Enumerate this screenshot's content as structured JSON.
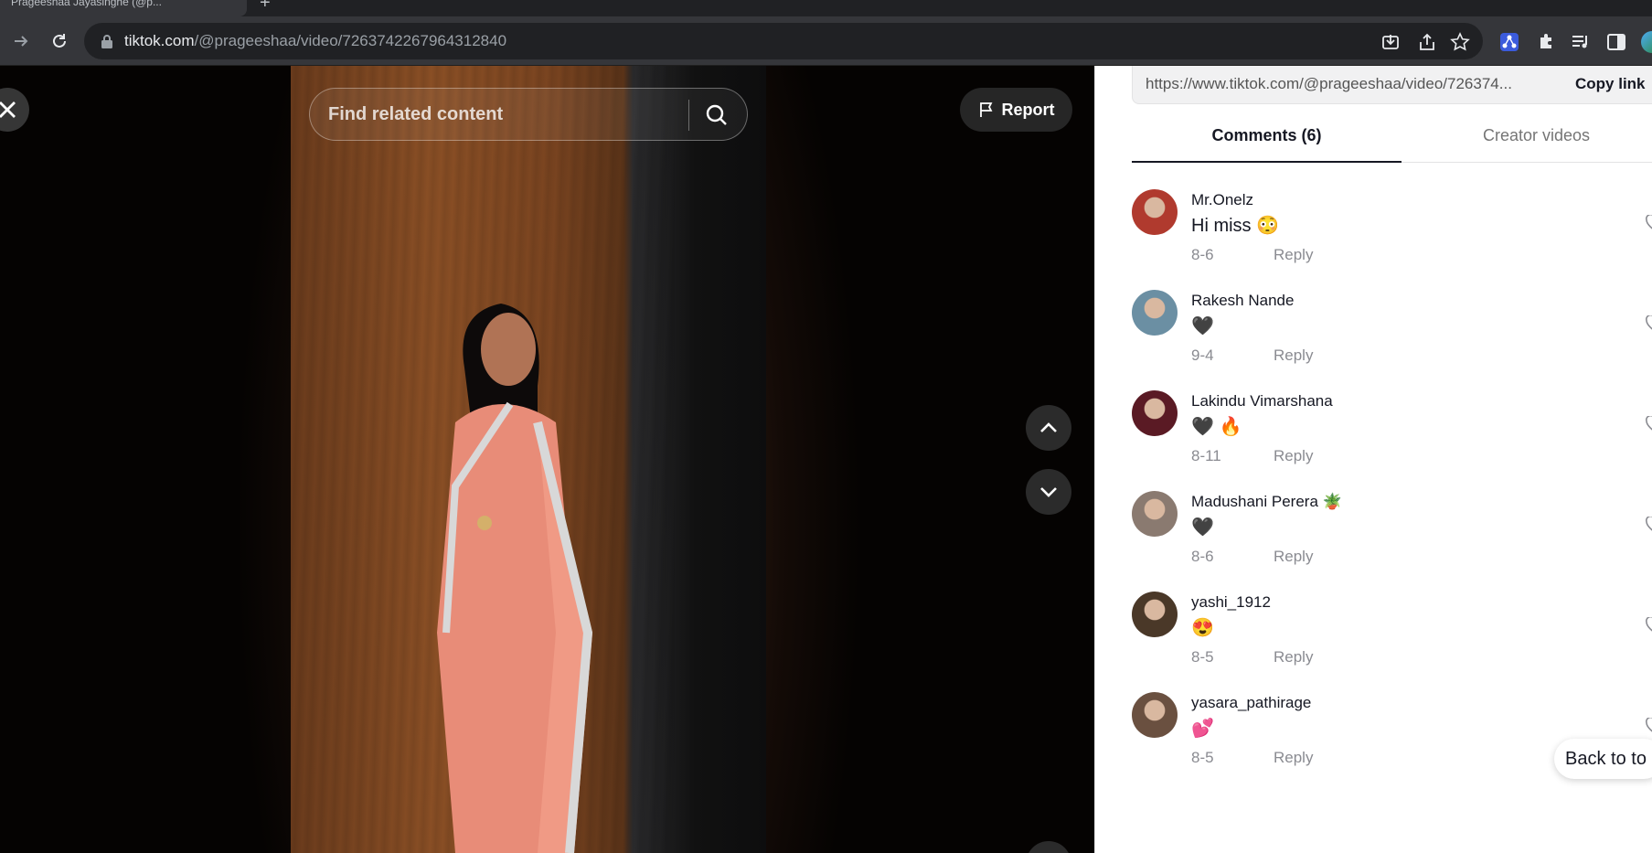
{
  "browser": {
    "tab_title": "Prageeshaa Jayasinghe (@p...",
    "url_host": "tiktok.com",
    "url_path": "/@prageeshaa/video/7263742267964312840"
  },
  "video": {
    "search_placeholder": "Find related content",
    "report_label": "Report"
  },
  "panel": {
    "share_url": "https://www.tiktok.com/@prageeshaa/video/726374...",
    "copy_link_label": "Copy link",
    "tabs": [
      {
        "label": "Comments (6)",
        "active": true
      },
      {
        "label": "Creator videos",
        "active": false
      }
    ],
    "reply_label": "Reply",
    "back_to_top_label": "Back to to",
    "comments": [
      {
        "user": "Mr.Onelz",
        "text": "Hi miss 😳",
        "date": "8-6",
        "avatar_color": "#b03a2e"
      },
      {
        "user": "Rakesh Nande",
        "text": "🖤",
        "date": "9-4",
        "avatar_color": "#6b8fa3"
      },
      {
        "user": "Lakindu Vimarshana",
        "text": "🖤 🔥",
        "date": "8-11",
        "avatar_color": "#5a1a24"
      },
      {
        "user": "Madushani Perera 🪴",
        "text": "🖤",
        "date": "8-6",
        "avatar_color": "#8a7a70"
      },
      {
        "user": "yashi_1912",
        "text": "😍",
        "date": "8-5",
        "avatar_color": "#4a3828"
      },
      {
        "user": "yasara_pathirage",
        "text": "💕",
        "date": "8-5",
        "avatar_color": "#6a5040"
      }
    ]
  }
}
